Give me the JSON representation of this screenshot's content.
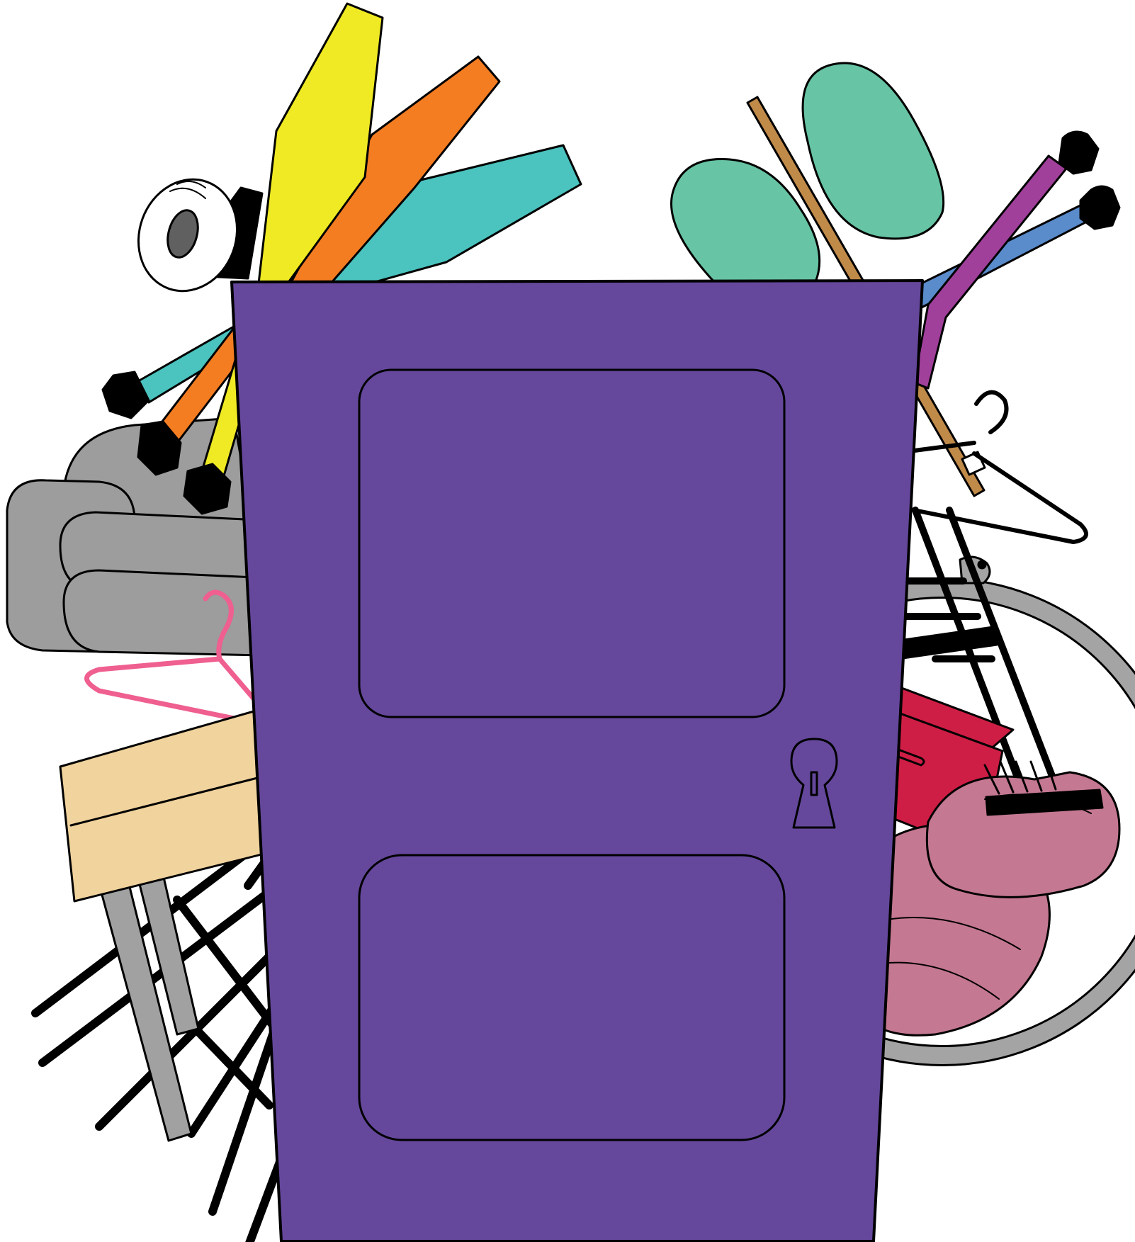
{
  "colors": {
    "background": "#ffffff",
    "outline": "#000000",
    "door": "#65489c",
    "pencil_yellow": "#f0ea24",
    "pencil_orange": "#f47d22",
    "pencil_teal": "#4bc3bf",
    "oven_mitt": "#67c4a5",
    "chopstick": "#c08a49",
    "needle_purple": "#a0409b",
    "needle_blue": "#5a8bcb",
    "cushion_gray": "#9c9d9c",
    "hanger_pink": "#ef5f8f",
    "stool_seat": "#f1d39d",
    "stool_leg": "#a1a1a1",
    "wheel_gray": "#a4a4a4",
    "red_box": "#cf1e45",
    "yarn_pink": "#c57891",
    "paper_roll": "#ffffff",
    "roll_core": "#606060"
  },
  "icons": [
    "door-icon",
    "keyhole-icon",
    "pencil-icon",
    "paper-roll-icon",
    "oven-mitt-icon",
    "chopstick-icon",
    "knitting-needle-icon",
    "hanger-icon",
    "stool-icon",
    "wheel-icon",
    "box-icon",
    "yarn-icon",
    "cushion-icon",
    "chair-icon"
  ]
}
